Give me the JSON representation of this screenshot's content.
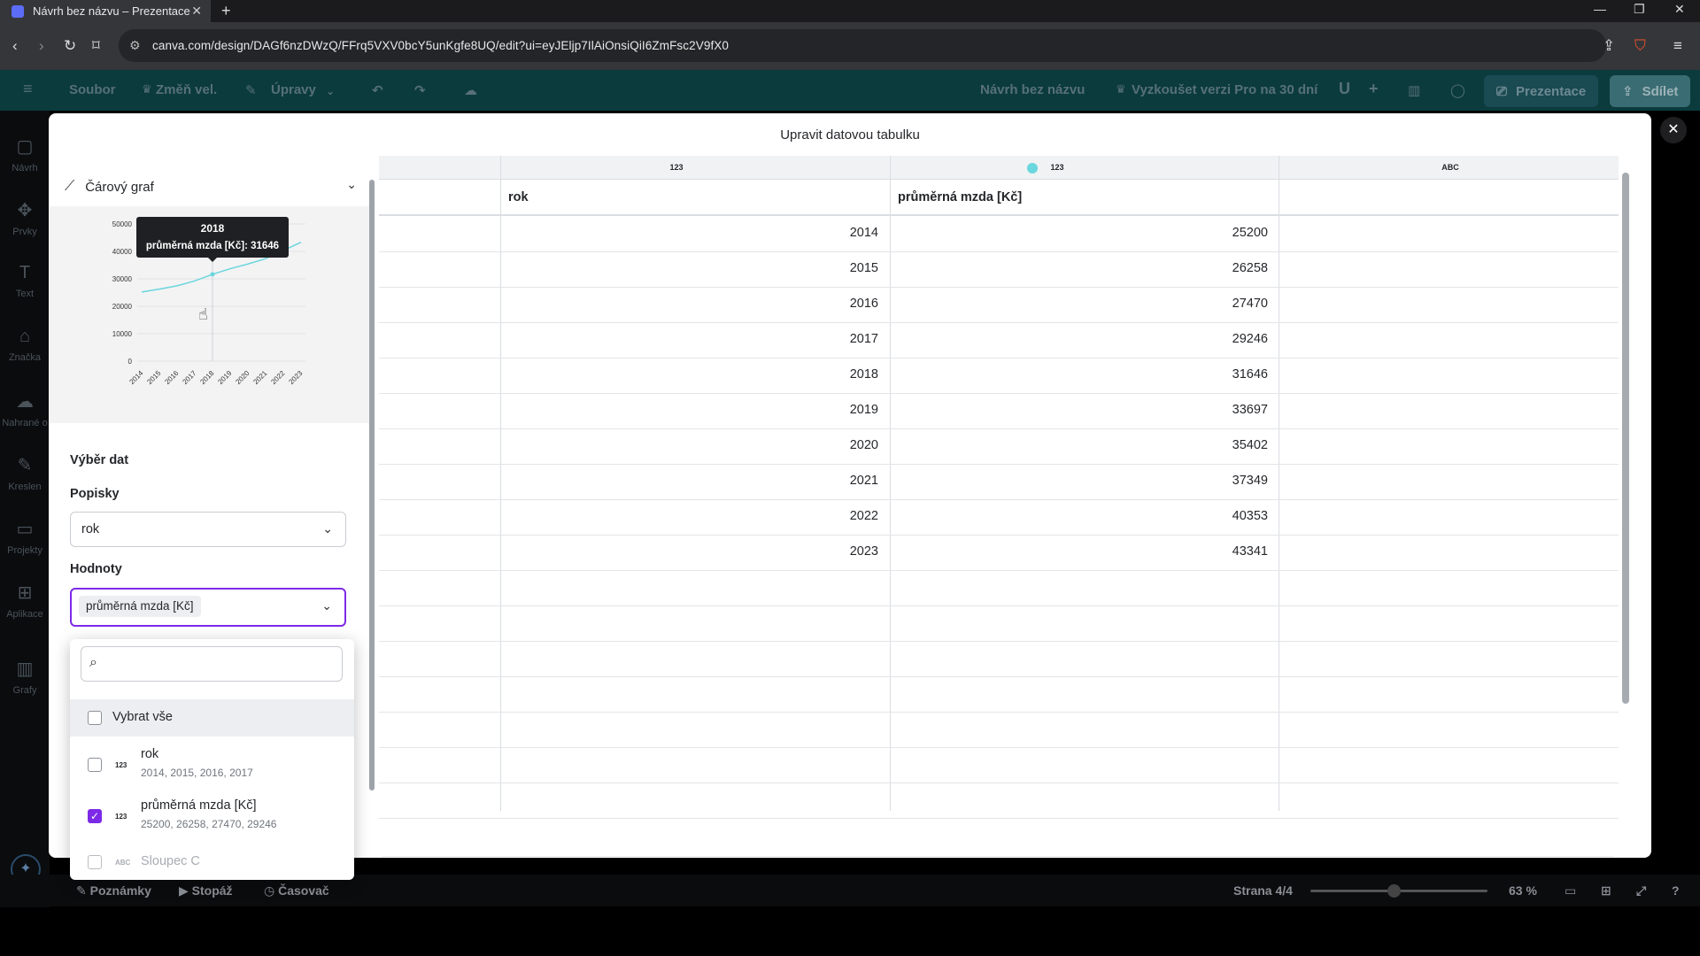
{
  "browser": {
    "tab_title": "Návrh bez názvu – Prezentace",
    "url": "canva.com/design/DAGf6nzDWzQ/FFrq5VXV0bcY5unKgfe8UQ/edit?ui=eyJEljp7IlAiOnsiQiI6ZmFsc2V9fX0"
  },
  "canva_header": {
    "file": "Soubor",
    "resize": "Změň vel.",
    "edit": "Úpravy",
    "design_name": "Návrh bez názvu",
    "pro_trial": "Vyzkoušet verzi Pro na 30 dní",
    "avatar": "U",
    "present": "Prezentace",
    "share": "Sdílet"
  },
  "rail": {
    "items": [
      "Návrh",
      "Prvky",
      "Text",
      "Značka",
      "Nahrané o",
      "Kreslen",
      "Projekty",
      "Aplikace",
      "Grafy"
    ]
  },
  "bottom_bar": {
    "notes": "Poznámky",
    "footage": "Stopáž",
    "timer": "Časovač",
    "page": "Strana 4/4",
    "zoom": "63 %"
  },
  "modal": {
    "title": "Upravit datovou tabulku",
    "chart_type": "Čárový graf",
    "data_selection": "Výběr dat",
    "labels_heading": "Popisky",
    "labels_value": "rok",
    "values_heading": "Hodnoty",
    "values_chip": "průměrná mzda [Kč]"
  },
  "dropdown": {
    "search_placeholder": "",
    "select_all": "Vybrat vše",
    "options": [
      {
        "type": "123",
        "name": "rok",
        "preview": "2014, 2015, 2016, 2017",
        "checked": false
      },
      {
        "type": "123",
        "name": "průměrná mzda [Kč]",
        "preview": "25200, 26258, 27470, 29246",
        "checked": true
      },
      {
        "type": "ABC",
        "name": "Sloupec C",
        "preview": "",
        "checked": false
      }
    ]
  },
  "table": {
    "column_types": [
      "123",
      "123",
      "ABC"
    ],
    "header_row": [
      "rok",
      "průměrná mzda [Kč]",
      ""
    ],
    "rows": [
      [
        "2014",
        "25200"
      ],
      [
        "2015",
        "26258"
      ],
      [
        "2016",
        "27470"
      ],
      [
        "2017",
        "29246"
      ],
      [
        "2018",
        "31646"
      ],
      [
        "2019",
        "33697"
      ],
      [
        "2020",
        "35402"
      ],
      [
        "2021",
        "37349"
      ],
      [
        "2022",
        "40353"
      ],
      [
        "2023",
        "43341"
      ]
    ]
  },
  "chart_data": {
    "type": "line",
    "x": [
      "2014",
      "2015",
      "2016",
      "2017",
      "2018",
      "2019",
      "2020",
      "2021",
      "2022",
      "2023"
    ],
    "series": [
      {
        "name": "průměrná mzda [Kč]",
        "values": [
          25200,
          26258,
          27470,
          29246,
          31646,
          33697,
          35402,
          37349,
          40353,
          43341
        ],
        "color": "#6ad6dd"
      }
    ],
    "y_ticks": [
      "0",
      "10000",
      "20000",
      "30000",
      "40000",
      "50000"
    ],
    "ylim": [
      0,
      50000
    ],
    "tooltip": {
      "title": "2018",
      "text": "průměrná mzda [Kč]: 31646"
    }
  }
}
